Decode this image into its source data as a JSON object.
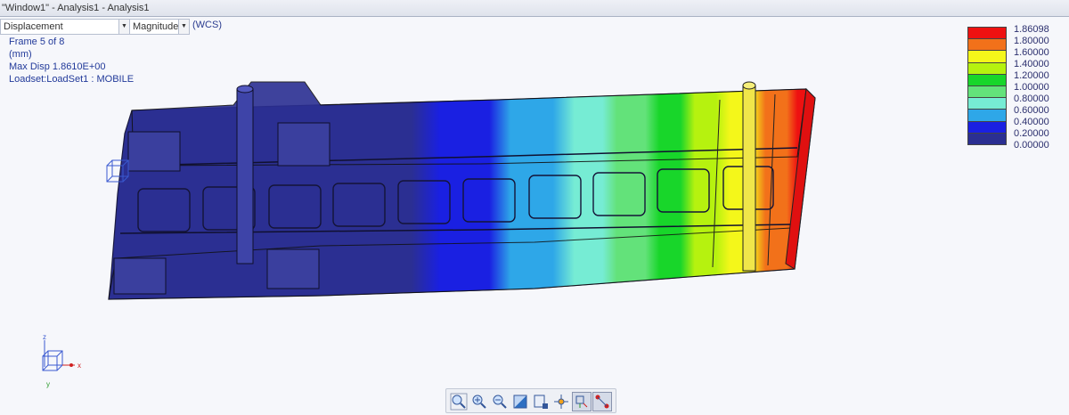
{
  "window": {
    "title": "\"Window1\" - Analysis1 - Analysis1"
  },
  "toolbar": {
    "quantity": "Displacement",
    "component": "Magnitude",
    "coord_system": "(WCS)"
  },
  "info": {
    "frame": "Frame 5 of 8",
    "units": "(mm)",
    "max_disp": "Max Disp  1.8610E+00",
    "loadset": "Loadset:LoadSet1 :  MOBILE"
  },
  "legend": {
    "values": [
      "1.86098",
      "1.80000",
      "1.60000",
      "1.40000",
      "1.20000",
      "1.00000",
      "0.80000",
      "0.60000",
      "0.40000",
      "0.20000",
      "0.00000"
    ],
    "colors": [
      "#ee1111",
      "#f2711a",
      "#f4f71a",
      "#b6f20f",
      "#18d62a",
      "#63e27a",
      "#76ecd4",
      "#2ea7e8",
      "#1a20e2",
      "#2b2f92"
    ]
  },
  "triad": {
    "x": "x",
    "y": "y",
    "z": "z"
  },
  "view_toolbar": {
    "buttons": [
      "refit-icon",
      "zoom-in-icon",
      "zoom-out-icon",
      "shaded-display-icon",
      "view-manager-icon",
      "spin-center-icon",
      "display-style-icon",
      "datum-display-icon"
    ]
  }
}
